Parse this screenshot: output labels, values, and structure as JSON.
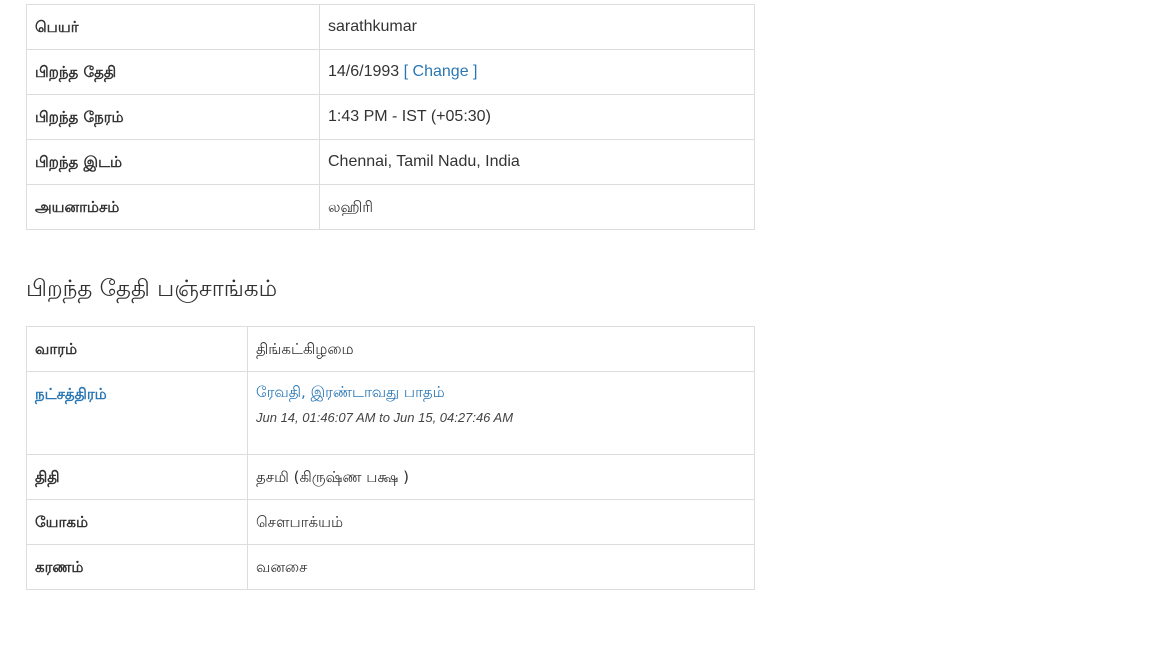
{
  "birth_details": {
    "rows": [
      {
        "label": "பெயர்",
        "value": "sarathkumar"
      },
      {
        "label": "பிறந்த தேதி",
        "value": "14/6/1993",
        "link_open": "[",
        "link_text": "Change",
        "link_close": "]"
      },
      {
        "label": "பிறந்த நேரம்",
        "value": "1:43 PM - IST (+05:30)"
      },
      {
        "label": "பிறந்த இடம்",
        "value": "Chennai, Tamil Nadu, India"
      },
      {
        "label": "அயனாம்சம்",
        "value": "லஹிரி"
      }
    ]
  },
  "panchangam": {
    "heading": "பிறந்த தேதி பஞ்சாங்கம்",
    "rows": [
      {
        "label": "வாரம்",
        "value": "திங்கட்கிழமை"
      },
      {
        "label": "நட்சத்திரம்",
        "value": "ரேவதி, இரண்டாவது பாதம்",
        "range": "Jun 14, 01:46:07 AM to Jun 15, 04:27:46 AM"
      },
      {
        "label": "திதி",
        "value": "தசமி (கிருஷ்ண பக்ஷ )"
      },
      {
        "label": "யோகம்",
        "value": "சௌபாக்யம்"
      },
      {
        "label": "கரணம்",
        "value": "வனசை"
      }
    ]
  },
  "colors": {
    "link": "#2a77b4",
    "border": "#dddddd",
    "text": "#333333"
  }
}
